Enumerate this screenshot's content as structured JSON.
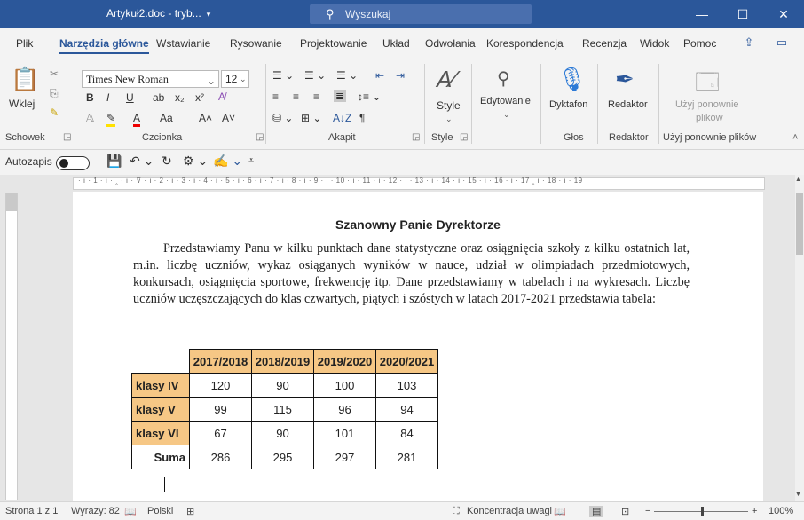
{
  "titlebar": {
    "doc_title": "Artykuł2.doc  -  tryb...",
    "dropdown": "▾",
    "search_icon": "⚲",
    "search_placeholder": "Wyszukaj",
    "minimize": "—",
    "restore": "☐",
    "close": "✕"
  },
  "tabs": [
    "Plik",
    "Narzędzia główne",
    "Wstawianie",
    "Rysowanie",
    "Projektowanie",
    "Układ",
    "Odwołania",
    "Korespondencja",
    "Recenzja",
    "Widok",
    "Pomoc"
  ],
  "ribbon": {
    "paste_label": "Wklej",
    "font_name": "Times New Roman",
    "font_size": "12",
    "group_clipboard": "Schowek",
    "group_font": "Czcionka",
    "group_paragraph": "Akapit",
    "group_styles": "Style",
    "group_voice": "Głos",
    "group_editor": "Redaktor",
    "group_reuse": "Użyj ponownie plików",
    "styles_label": "Style",
    "editing_label": "Edytowanie",
    "dictate_label": "Dyktafon",
    "editor_label": "Redaktor",
    "reuse_label_1": "Użyj ponownie",
    "reuse_label_2": "plików",
    "bold": "B",
    "italic": "I",
    "underline": "U",
    "strike": "ab",
    "subscript": "x₂",
    "superscript": "x²",
    "case": "Aa",
    "grow": "A˄",
    "shrink": "A˅",
    "pilcrow": "¶",
    "sort": "A↓Z"
  },
  "qat": {
    "autosave_label": "Autozapis"
  },
  "ruler": {
    "marks": "· ı · 1 · ı · ‸ · ı · ⊽ · ı · 2 · ı · 3 · ı · 4 · ı · 5 · ı · 6 · ı · 7 · ı · 8 · ı · 9 · ı · 10 · ı · 11 · ı · 12 · ı · 13 · ı · 14 · ı · 15 · ı · 16 · ı · 17 ‸ ı · 18 · ı · 19"
  },
  "document": {
    "heading": "Szanowny Panie Dyrektorze",
    "paragraph": "Przedstawiamy Panu w kilku punktach dane statystyczne oraz osiągnięcia szkoły z kilku ostatnich lat, m.in. liczbę uczniów, wykaz osiąganych wyników w nauce, udział w olimpiadach przedmiotowych, konkursach, osiągnięcia sportowe, frekwencję itp. Dane przedstawiamy w tabelach i na wykresach. Liczbę uczniów uczęszczających do klas czwartych, piątych i szóstych w latach 2017-2021 przedstawia tabela:",
    "table": {
      "headers": [
        "2017/2018",
        "2018/2019",
        "2019/2020",
        "2020/2021"
      ],
      "rows": [
        {
          "label": "klasy IV",
          "values": [
            "120",
            "90",
            "100",
            "103"
          ]
        },
        {
          "label": "klasy V",
          "values": [
            "99",
            "115",
            "96",
            "94"
          ]
        },
        {
          "label": "klasy VI",
          "values": [
            "67",
            "90",
            "101",
            "84"
          ]
        },
        {
          "label": "Suma",
          "values": [
            "286",
            "295",
            "297",
            "281"
          ]
        }
      ]
    }
  },
  "status": {
    "page": "Strona 1 z 1",
    "words": "Wyrazy: 82",
    "language": "Polski",
    "focus": "Koncentracja uwagi",
    "zoom": "100%",
    "zoom_minus": "−",
    "zoom_plus": "+"
  }
}
